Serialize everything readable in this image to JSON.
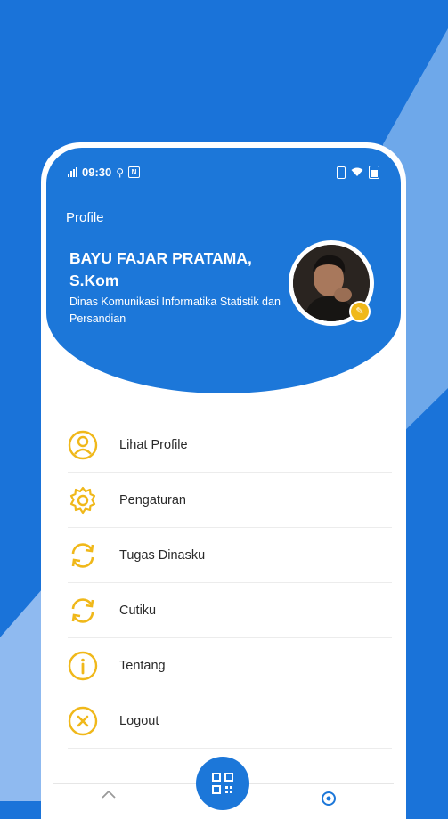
{
  "status_bar": {
    "time": "09:30"
  },
  "header": {
    "title": "Profile",
    "name": "BAYU FAJAR PRATAMA, S.Kom",
    "department": "Dinas Komunikasi Informatika Statistik dan Persandian"
  },
  "menu": [
    {
      "label": "Lihat Profile",
      "icon": "user-circle-icon"
    },
    {
      "label": "Pengaturan",
      "icon": "gear-icon"
    },
    {
      "label": "Tugas Dinasku",
      "icon": "refresh-icon"
    },
    {
      "label": "Cutiku",
      "icon": "refresh-icon"
    },
    {
      "label": "Tentang",
      "icon": "info-icon"
    },
    {
      "label": "Logout",
      "icon": "close-circle-icon"
    }
  ],
  "colors": {
    "primary": "#1c77d9",
    "accent": "#f0b81a",
    "background": "#1a73d9"
  },
  "bottom_nav": {
    "center_icon": "qr-code-icon"
  }
}
